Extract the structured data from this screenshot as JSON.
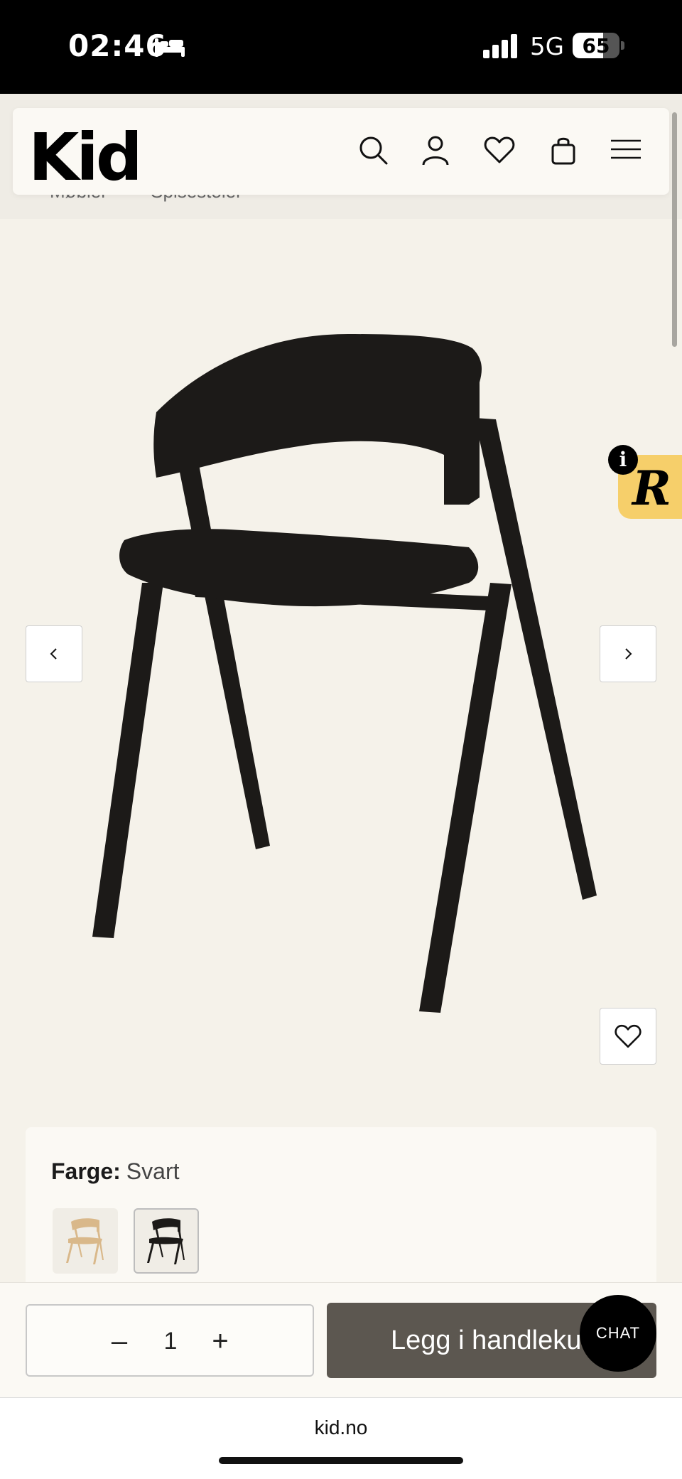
{
  "status_bar": {
    "time": "02:46",
    "network": "5G",
    "battery": "65",
    "battery_level": 0.65
  },
  "header": {
    "logo": "Kid",
    "icons": [
      "search-icon",
      "user-icon",
      "heart-icon",
      "bag-icon",
      "menu-icon"
    ]
  },
  "breadcrumb": [
    "Møbler",
    "Spisestoler"
  ],
  "product_gallery": {
    "prev_icon": "chevron-left-icon",
    "next_icon": "chevron-right-icon",
    "wishlist_icon": "heart-icon",
    "badge_letter": "R",
    "info_letter": "i"
  },
  "color_selector": {
    "label": "Farge:",
    "value": "Svart",
    "swatches": [
      {
        "name": "natural-oak",
        "color": "#d9b88a",
        "selected": false
      },
      {
        "name": "black",
        "color": "#1c1a18",
        "selected": true
      }
    ]
  },
  "action_bar": {
    "minus": "–",
    "quantity": "1",
    "plus": "+",
    "add_to_cart": "Legg i handlekurv",
    "chat": "CHAT"
  },
  "browser": {
    "url": "kid.no"
  },
  "colors": {
    "header_bg": "#fbf9f4",
    "page_bg": "#f5f2ea",
    "cart_button": "#5c5750",
    "badge": "#f6cf6a",
    "chair": "#1c1a18"
  }
}
